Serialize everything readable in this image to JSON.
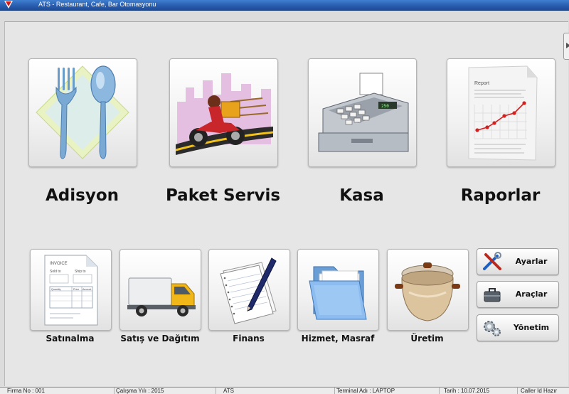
{
  "window": {
    "title": "ATS - Restaurant, Cafe, Bar Otomasyonu"
  },
  "main_modules": [
    {
      "label": "Adisyon",
      "icon": "cutlery-icon"
    },
    {
      "label": "Paket Servis",
      "icon": "delivery-motorcycle-icon"
    },
    {
      "label": "Kasa",
      "icon": "cash-register-icon"
    },
    {
      "label": "Raporlar",
      "icon": "report-chart-icon"
    }
  ],
  "sub_modules": [
    {
      "label": "Satınalma",
      "icon": "invoice-icon",
      "invoice_title": "INVOICE",
      "sold_to": "Sold to",
      "ship_to": "Ship to",
      "col_quantity": "Quantity",
      "col_price": "Price",
      "col_amount": "Amount"
    },
    {
      "label": "Satış ve Dağıtım",
      "icon": "delivery-truck-icon"
    },
    {
      "label": "Finans",
      "icon": "notebook-pencil-icon"
    },
    {
      "label": "Hizmet, Masraf",
      "icon": "folder-icon"
    },
    {
      "label": "Üretim",
      "icon": "cooking-pot-icon"
    }
  ],
  "report_tile_text": "Report",
  "utility_buttons": [
    {
      "label": "Ayarlar",
      "icon": "tools-icon"
    },
    {
      "label": "Araçlar",
      "icon": "toolbox-icon"
    },
    {
      "label": "Yönetim",
      "icon": "gears-icon"
    }
  ],
  "status_bar": [
    "Firma No : 001",
    "Çalışma Yılı : 2015",
    "ATS",
    "Terminal Adı : LAPTOP",
    "Tarih : 10.07.2015",
    "Caller Id Hazır"
  ],
  "colors": {
    "title_bar": "#2a5fb0",
    "background": "#dcdcdc",
    "tile": "#f4f4f4"
  }
}
